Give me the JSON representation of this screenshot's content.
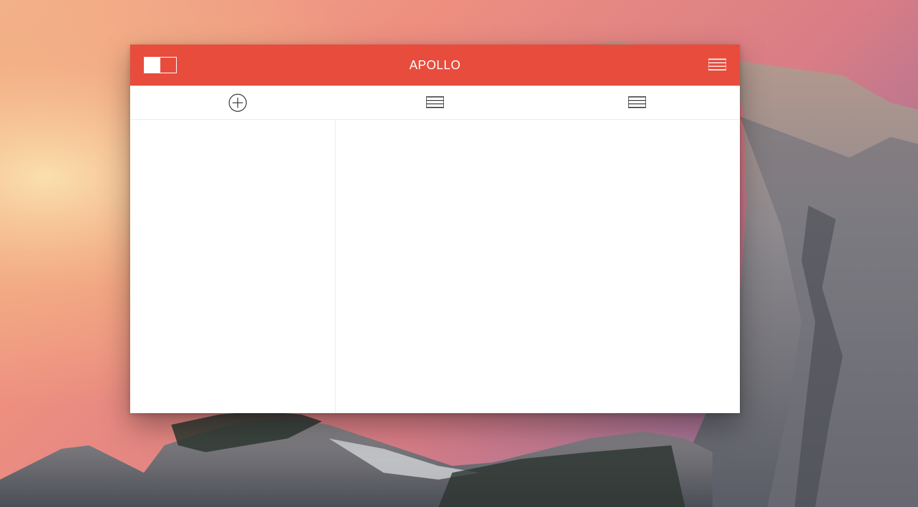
{
  "app": {
    "title": "APOLLO",
    "accent_color": "#e84c3d"
  },
  "titlebar": {
    "view_toggle_icon": "split-view-toggle-icon",
    "menu_icon": "hamburger-menu-icon"
  },
  "toolbar": {
    "items": [
      {
        "icon": "add-circle-icon"
      },
      {
        "icon": "list-icon"
      },
      {
        "icon": "list-icon"
      }
    ]
  }
}
